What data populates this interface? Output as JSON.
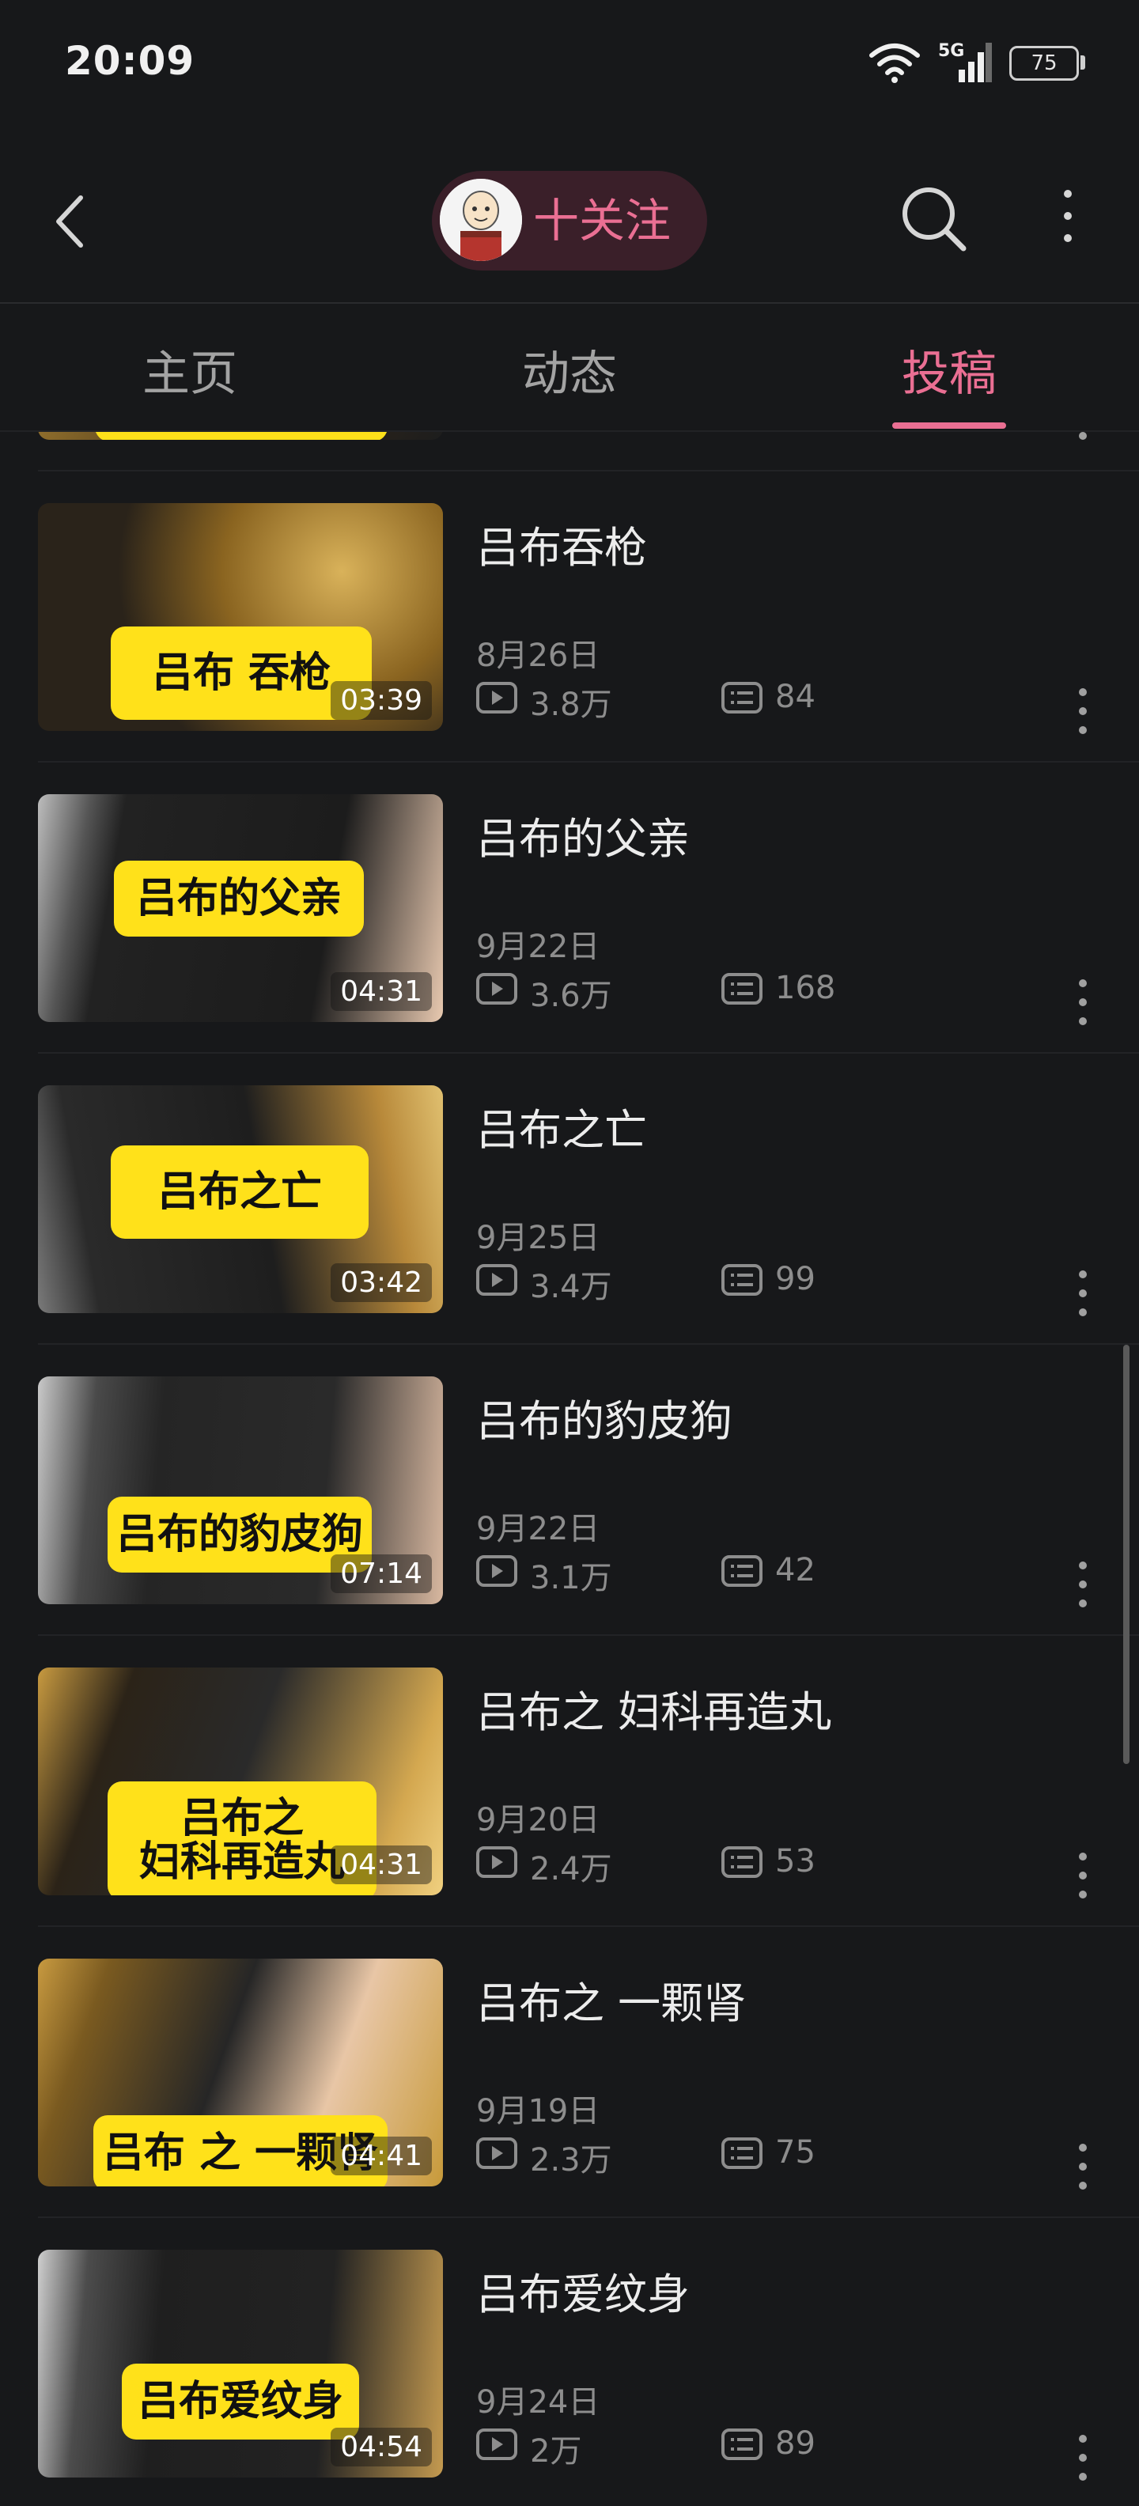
{
  "status_bar": {
    "time": "20:09",
    "network": "5G",
    "battery": "75"
  },
  "top_nav": {
    "follow_label": "十关注"
  },
  "tabs": [
    {
      "label": "主页",
      "active": false
    },
    {
      "label": "动态",
      "active": false
    },
    {
      "label": "投稿",
      "active": true
    }
  ],
  "colors": {
    "accent": "#ea6f93",
    "background": "#17181a",
    "caption_yellow": "#ffe11a"
  },
  "videos": [
    {
      "title": "吕布吞枪",
      "caption": "吕布 吞枪",
      "duration": "03:39",
      "date": "8月26日",
      "views": "3.8万",
      "comments": "84"
    },
    {
      "title": "吕布的父亲",
      "caption": "吕布的父亲",
      "duration": "04:31",
      "date": "9月22日",
      "views": "3.6万",
      "comments": "168"
    },
    {
      "title": "吕布之亡",
      "caption": "吕布之亡",
      "duration": "03:42",
      "date": "9月25日",
      "views": "3.4万",
      "comments": "99"
    },
    {
      "title": "吕布的豹皮狗",
      "caption": "吕布的豹皮狗",
      "duration": "07:14",
      "date": "9月22日",
      "views": "3.1万",
      "comments": "42"
    },
    {
      "title": "吕布之 妇科再造丸",
      "caption": "吕布之\n妇科再造丸",
      "duration": "04:31",
      "date": "9月20日",
      "views": "2.4万",
      "comments": "53"
    },
    {
      "title": "吕布之 一颗肾",
      "caption": "吕布 之 一颗肾",
      "duration": "04:41",
      "date": "9月19日",
      "views": "2.3万",
      "comments": "75"
    },
    {
      "title": "吕布爱纹身",
      "caption": "吕布爱纹身",
      "duration": "04:54",
      "date": "9月24日",
      "views": "2万",
      "comments": "89"
    }
  ]
}
